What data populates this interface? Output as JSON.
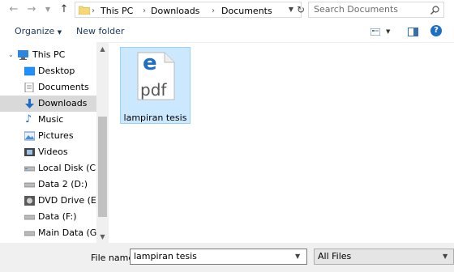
{
  "address": {
    "crumbs": [
      "This PC",
      "Downloads",
      "Documents"
    ]
  },
  "search": {
    "placeholder": "Search Documents"
  },
  "toolbar": {
    "organize": "Organize",
    "new_folder": "New folder"
  },
  "nav": {
    "items": [
      {
        "label": "This PC"
      },
      {
        "label": "Desktop"
      },
      {
        "label": "Documents"
      },
      {
        "label": "Downloads"
      },
      {
        "label": "Music"
      },
      {
        "label": "Pictures"
      },
      {
        "label": "Videos"
      },
      {
        "label": "Local Disk (C:)"
      },
      {
        "label": "Data 2 (D:)"
      },
      {
        "label": "DVD Drive (E:) PE"
      },
      {
        "label": "Data (F:)"
      },
      {
        "label": "Main Data (G:)"
      }
    ]
  },
  "files": [
    {
      "name": "lampiran tesis",
      "icon_text": "pdf",
      "icon_letter": "e"
    }
  ],
  "bottom": {
    "file_name_label": "File name:",
    "file_name_value": "lampiran tesis",
    "file_type_value": "All Files"
  },
  "colors": {
    "selection": "#cce8ff",
    "accent": "#1e6fc4"
  }
}
